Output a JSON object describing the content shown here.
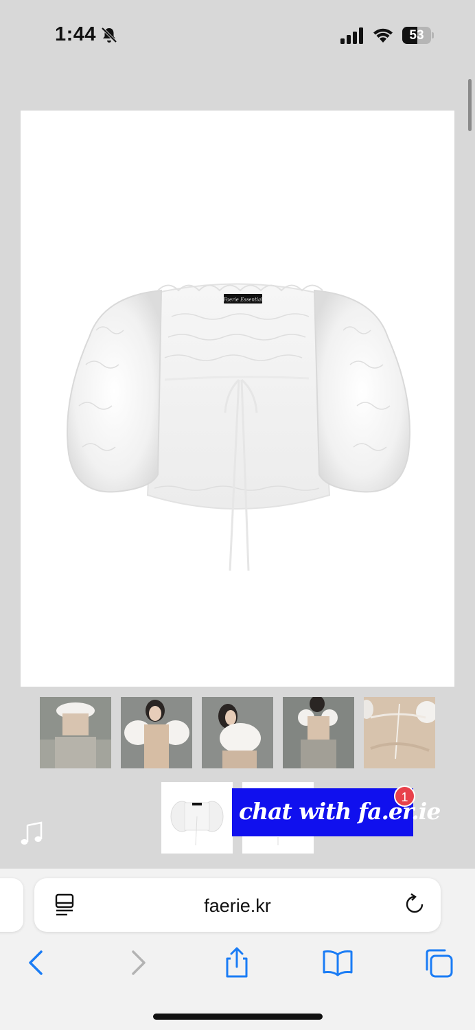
{
  "status_bar": {
    "time": "1:44",
    "battery_level": "53",
    "battery_percent": 53
  },
  "product": {
    "label_text": "Faerie Essential",
    "thumbnail_count": 7
  },
  "chat": {
    "label": "chat with fa.er.ie",
    "badge_count": "1",
    "bg_color": "#1010ee",
    "badge_color": "#e8414b"
  },
  "browser": {
    "url": "faerie.kr",
    "accent_color": "#1a7cf5"
  },
  "icons": [
    "bell-slash-icon",
    "signal-icon",
    "wifi-icon",
    "battery-icon",
    "music-note-icon",
    "reader-icon",
    "reload-icon",
    "back-icon",
    "forward-icon",
    "share-icon",
    "bookmarks-icon",
    "tabs-icon"
  ]
}
